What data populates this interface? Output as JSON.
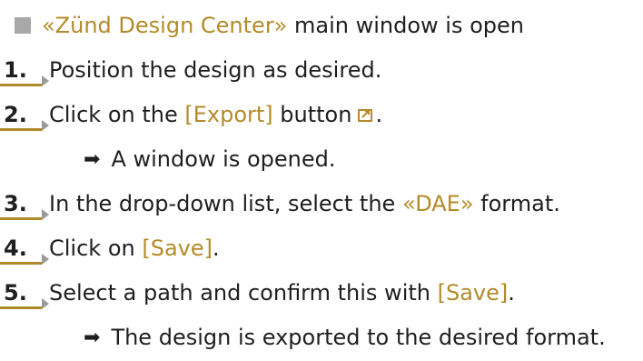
{
  "precondition": {
    "text_before": "«Zünd Design Center»",
    "text_after": " main window is open"
  },
  "steps": [
    {
      "number": "1.",
      "text": "Position the design as desired."
    },
    {
      "number": "2.",
      "pre": "Click on the ",
      "button": "[Export]",
      "post": " button",
      "suffix": "."
    },
    {
      "result": "A window is opened."
    },
    {
      "number": "3.",
      "pre": "In the drop-down list, select the ",
      "format": "«DAE»",
      "post": " format."
    },
    {
      "number": "4.",
      "pre": "Click on ",
      "button": "[Save]",
      "post": "."
    },
    {
      "number": "5.",
      "pre": "Select a path and confirm this with ",
      "button": "[Save]",
      "post": "."
    },
    {
      "result": "The design is exported to the desired format."
    }
  ],
  "colors": {
    "highlight": "#b38b2a",
    "bullet": "#a8a8a8"
  },
  "icons": {
    "bullet": "square-bullet-icon",
    "result": "arrow-right-icon",
    "export": "export-icon"
  }
}
